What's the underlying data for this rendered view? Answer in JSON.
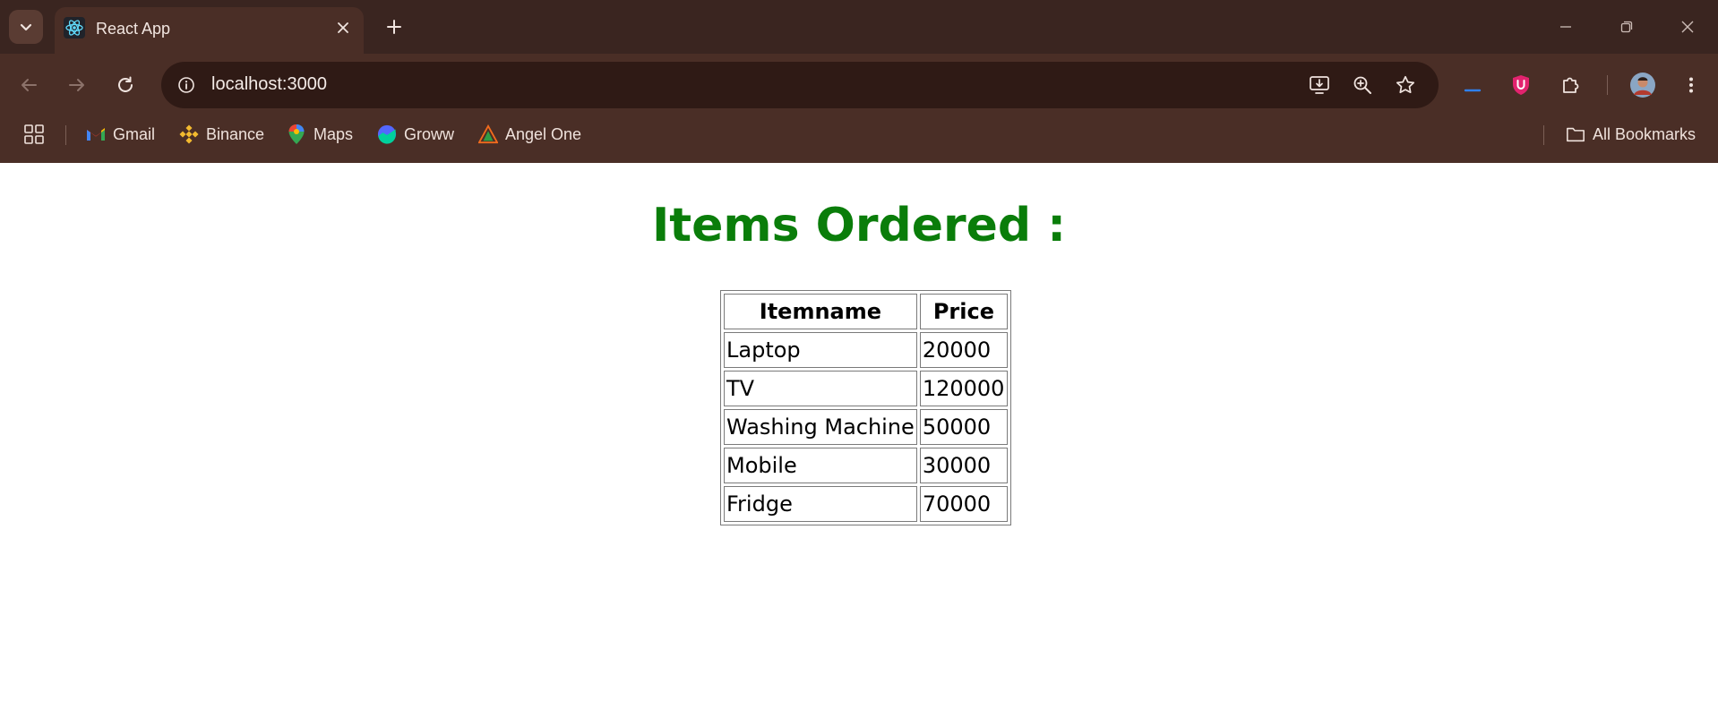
{
  "browser": {
    "tab": {
      "title": "React App",
      "favicon": "react-icon"
    },
    "address_bar": {
      "url": "localhost:3000"
    },
    "bookmarks": [
      {
        "label": "Gmail",
        "icon": "gmail-icon"
      },
      {
        "label": "Binance",
        "icon": "binance-icon"
      },
      {
        "label": "Maps",
        "icon": "maps-icon"
      },
      {
        "label": "Groww",
        "icon": "groww-icon"
      },
      {
        "label": "Angel One",
        "icon": "angel-one-icon"
      }
    ],
    "all_bookmarks_label": "All Bookmarks",
    "colors": {
      "frame": "#3a2520",
      "toolbar": "#4a2e26",
      "omnibox": "#2f1a15"
    }
  },
  "page": {
    "heading": "Items Ordered :",
    "heading_color": "#0a7d0a",
    "table": {
      "headers": [
        "Itemname",
        "Price"
      ],
      "rows": [
        [
          "Laptop",
          "20000"
        ],
        [
          "TV",
          "120000"
        ],
        [
          "Washing Machine",
          "50000"
        ],
        [
          "Mobile",
          "30000"
        ],
        [
          "Fridge",
          "70000"
        ]
      ]
    }
  }
}
